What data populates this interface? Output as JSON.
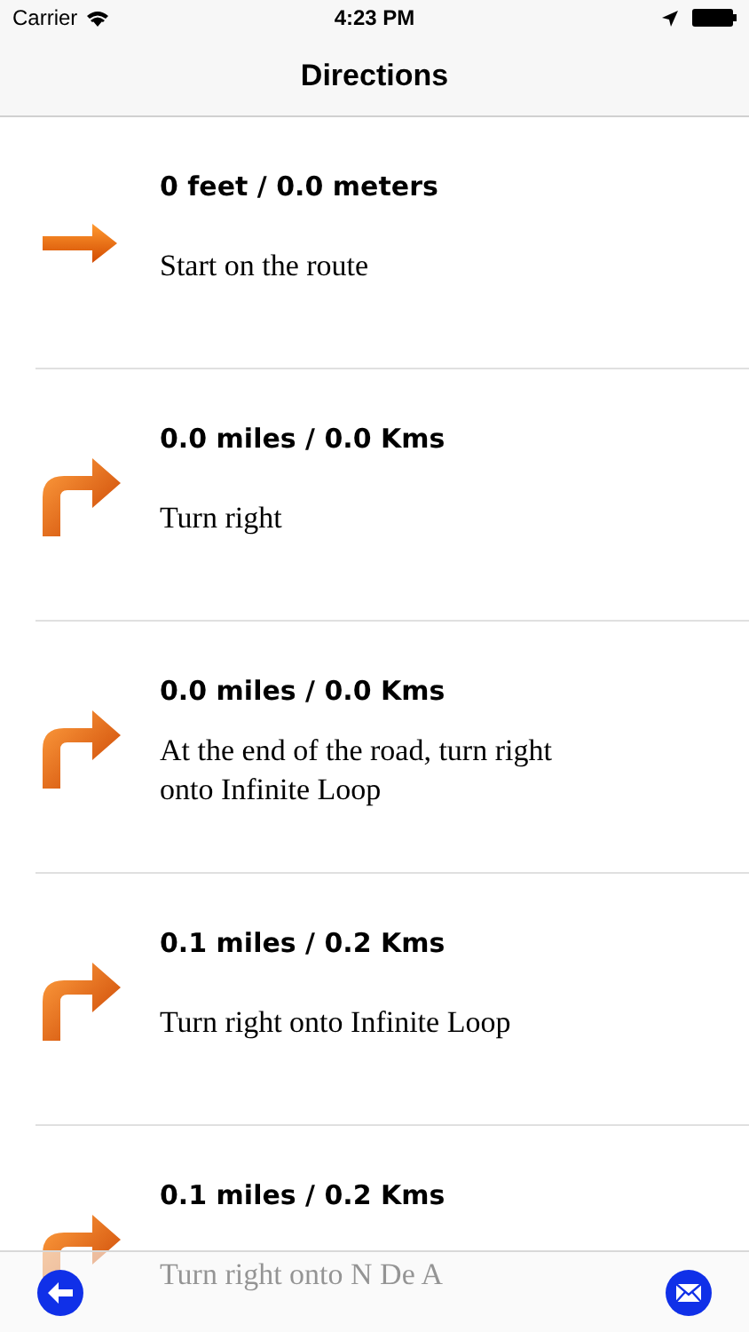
{
  "status_bar": {
    "carrier": "Carrier",
    "time": "4:23 PM"
  },
  "nav_bar": {
    "title": "Directions"
  },
  "steps": [
    {
      "kind": "straight",
      "distance": "0 feet / 0.0 meters",
      "instruction": "Start on the route"
    },
    {
      "kind": "right",
      "distance": "0.0 miles / 0.0 Kms",
      "instruction": "Turn right"
    },
    {
      "kind": "right",
      "distance": "0.0 miles / 0.0 Kms",
      "instruction": "At the end of the road, turn right onto Infinite Loop"
    },
    {
      "kind": "right",
      "distance": "0.1 miles / 0.2 Kms",
      "instruction": "Turn right onto Infinite Loop"
    },
    {
      "kind": "right",
      "distance": "0.1 miles / 0.2 Kms",
      "instruction": "Turn right onto N De A"
    }
  ]
}
